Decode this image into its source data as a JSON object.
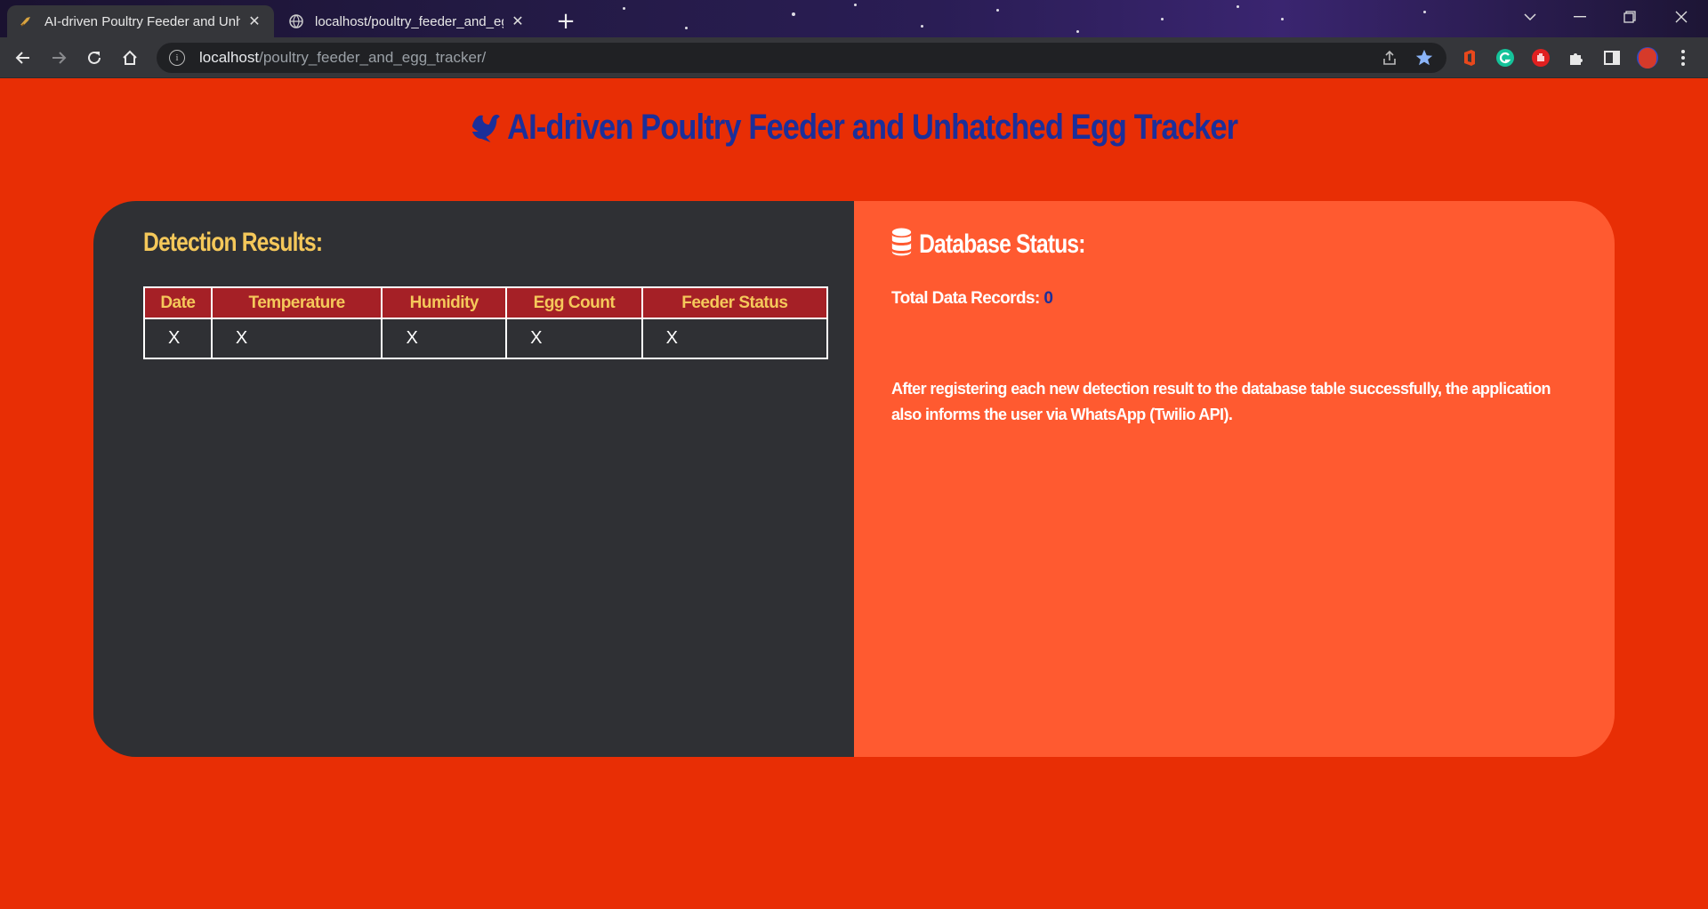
{
  "browser": {
    "tabs": [
      {
        "title": "AI-driven Poultry Feeder and Unh",
        "active": true,
        "icon": "bird-favicon"
      },
      {
        "title": "localhost/poultry_feeder_and_egg",
        "active": false,
        "icon": "globe-icon"
      }
    ],
    "address": {
      "host": "localhost",
      "path": "/poultry_feeder_and_egg_tracker/"
    }
  },
  "page": {
    "title": "AI-driven Poultry Feeder and Unhatched Egg Tracker",
    "detection": {
      "heading": "Detection Results:",
      "columns": [
        "Date",
        "Temperature",
        "Humidity",
        "Egg Count",
        "Feeder Status"
      ],
      "rows": [
        [
          "X",
          "X",
          "X",
          "X",
          "X"
        ]
      ]
    },
    "database": {
      "heading": "Database Status:",
      "records_label": "Total Data Records:",
      "records_count": "0",
      "note": "After registering each new detection result to the database table successfully, the application also informs the user via WhatsApp (Twilio API)."
    }
  },
  "colors": {
    "page_bg": "#e82e05",
    "title": "#1b2f9a",
    "left_panel": "#2f3034",
    "right_panel": "#ff5a30",
    "table_header": "#a52026",
    "accent_yellow": "#f5c85a"
  }
}
